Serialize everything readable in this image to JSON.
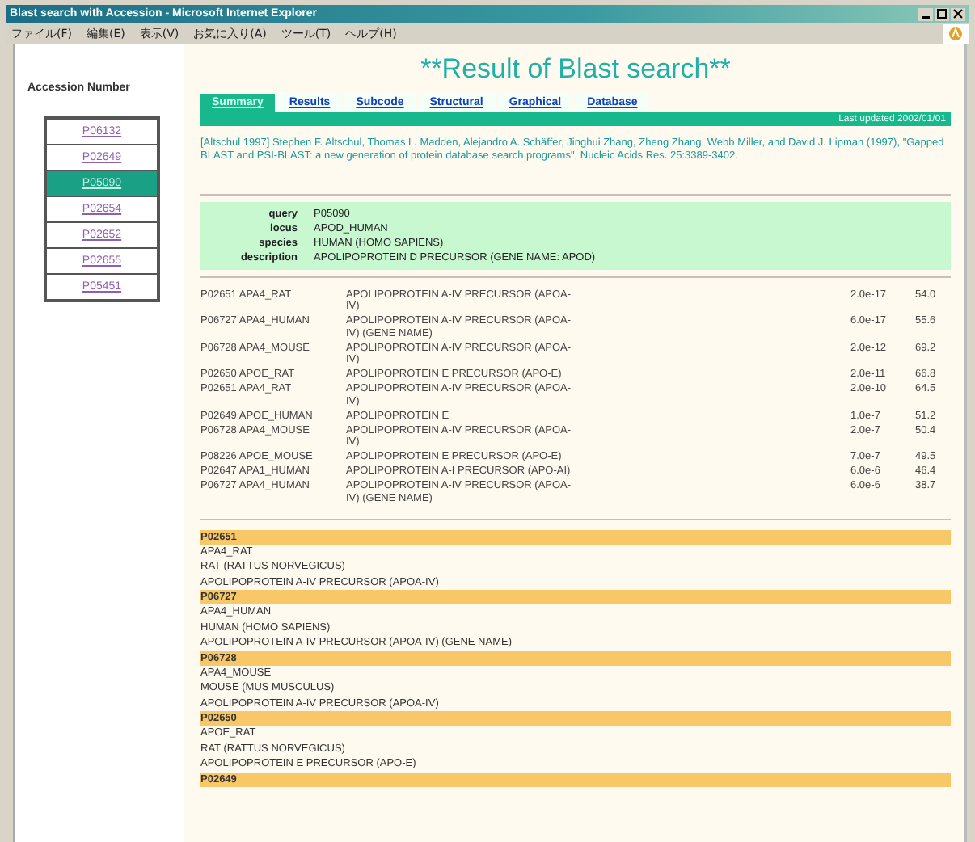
{
  "window": {
    "title": "Blast search with Accession - Microsoft Internet Explorer"
  },
  "menu": [
    "ファイル(F)",
    "編集(E)",
    "表示(V)",
    "お気に入り(A)",
    "ツール(T)",
    "ヘルプ(H)"
  ],
  "page_title": "**Result of Blast search**",
  "sidebar": {
    "heading": "Accession Number",
    "items": [
      {
        "label": "P06132",
        "selected": false
      },
      {
        "label": "P02649",
        "selected": false
      },
      {
        "label": "P05090",
        "selected": true
      },
      {
        "label": "P02654",
        "selected": false
      },
      {
        "label": "P02652",
        "selected": false
      },
      {
        "label": "P02655",
        "selected": false
      },
      {
        "label": "P05451",
        "selected": false
      }
    ]
  },
  "tabs": [
    {
      "label": "Summary",
      "selected": true
    },
    {
      "label": "Results",
      "selected": false
    },
    {
      "label": "Subcode",
      "selected": false
    },
    {
      "label": "Structural",
      "selected": false
    },
    {
      "label": "Graphical",
      "selected": false
    },
    {
      "label": "Database",
      "selected": false
    }
  ],
  "tab_bar_note": "Last updated 2002/01/01",
  "citation": "[Altschul 1997] Stephen F. Altschul, Thomas L. Madden, Alejandro A. Schäffer, Jinghui Zhang, Zheng Zhang, Webb Miller, and David J. Lipman (1997), \"Gapped BLAST and PSI-BLAST: a new generation of protein database search programs\", Nucleic Acids Res. 25:3389-3402.",
  "query": [
    {
      "label": "query",
      "value": "P05090"
    },
    {
      "label": "locus",
      "value": "APOD_HUMAN"
    },
    {
      "label": "species",
      "value": "HUMAN (HOMO SAPIENS)"
    },
    {
      "label": "description",
      "value": "APOLIPOPROTEIN D PRECURSOR (GENE NAME: APOD)"
    }
  ],
  "hits": [
    {
      "id": "P02651 APA4_RAT",
      "description": "APOLIPOPROTEIN A-IV PRECURSOR (APOA-IV)",
      "evalue": "2.0e-17",
      "score": "54.0"
    },
    {
      "id": "P06727 APA4_HUMAN",
      "description": "APOLIPOPROTEIN A-IV PRECURSOR (APOA-IV) (GENE NAME)",
      "evalue": "6.0e-17",
      "score": "55.6"
    },
    {
      "id": "P06728 APA4_MOUSE",
      "description": "APOLIPOPROTEIN A-IV PRECURSOR (APOA-IV)",
      "evalue": "2.0e-12",
      "score": "69.2"
    },
    {
      "id": "P02650 APOE_RAT",
      "description": "APOLIPOPROTEIN E PRECURSOR (APO-E)",
      "evalue": "2.0e-11",
      "score": "66.8"
    },
    {
      "id": "P02651 APA4_RAT",
      "description": "APOLIPOPROTEIN A-IV PRECURSOR (APOA-IV)",
      "evalue": "2.0e-10",
      "score": "64.5"
    },
    {
      "id": "P02649 APOE_HUMAN",
      "description": "APOLIPOPROTEIN E",
      "evalue": "1.0e-7",
      "score": "51.2"
    },
    {
      "id": "P06728 APA4_MOUSE",
      "description": "APOLIPOPROTEIN A-IV PRECURSOR (APOA-IV)",
      "evalue": "2.0e-7",
      "score": "50.4"
    },
    {
      "id": "P08226 APOE_MOUSE",
      "description": "APOLIPOPROTEIN E PRECURSOR (APO-E)",
      "evalue": "7.0e-7",
      "score": "49.5"
    },
    {
      "id": "P02647 APA1_HUMAN",
      "description": "APOLIPOPROTEIN A-I PRECURSOR (APO-AI)",
      "evalue": "6.0e-6",
      "score": "46.4"
    },
    {
      "id": "P06727 APA4_HUMAN",
      "description": "APOLIPOPROTEIN A-IV PRECURSOR (APOA-IV) (GENE NAME)",
      "evalue": "6.0e-6",
      "score": "38.7"
    }
  ],
  "details": [
    {
      "id": "P02651",
      "lines": [
        "APA4_RAT",
        "RAT (RATTUS NORVEGICUS)",
        "APOLIPOPROTEIN A-IV PRECURSOR (APOA-IV)"
      ]
    },
    {
      "id": "P06727",
      "lines": [
        "APA4_HUMAN",
        "HUMAN (HOMO SAPIENS)",
        "APOLIPOPROTEIN A-IV PRECURSOR (APOA-IV) (GENE NAME)"
      ]
    },
    {
      "id": "P06728",
      "lines": [
        "APA4_MOUSE",
        "MOUSE (MUS MUSCULUS)",
        "APOLIPOPROTEIN A-IV PRECURSOR (APOA-IV)"
      ]
    },
    {
      "id": "P02650",
      "lines": [
        "APOE_RAT",
        "RAT (RATTUS NORVEGICUS)",
        "APOLIPOPROTEIN E PRECURSOR (APO-E)"
      ]
    },
    {
      "id": "P02649"
    }
  ]
}
